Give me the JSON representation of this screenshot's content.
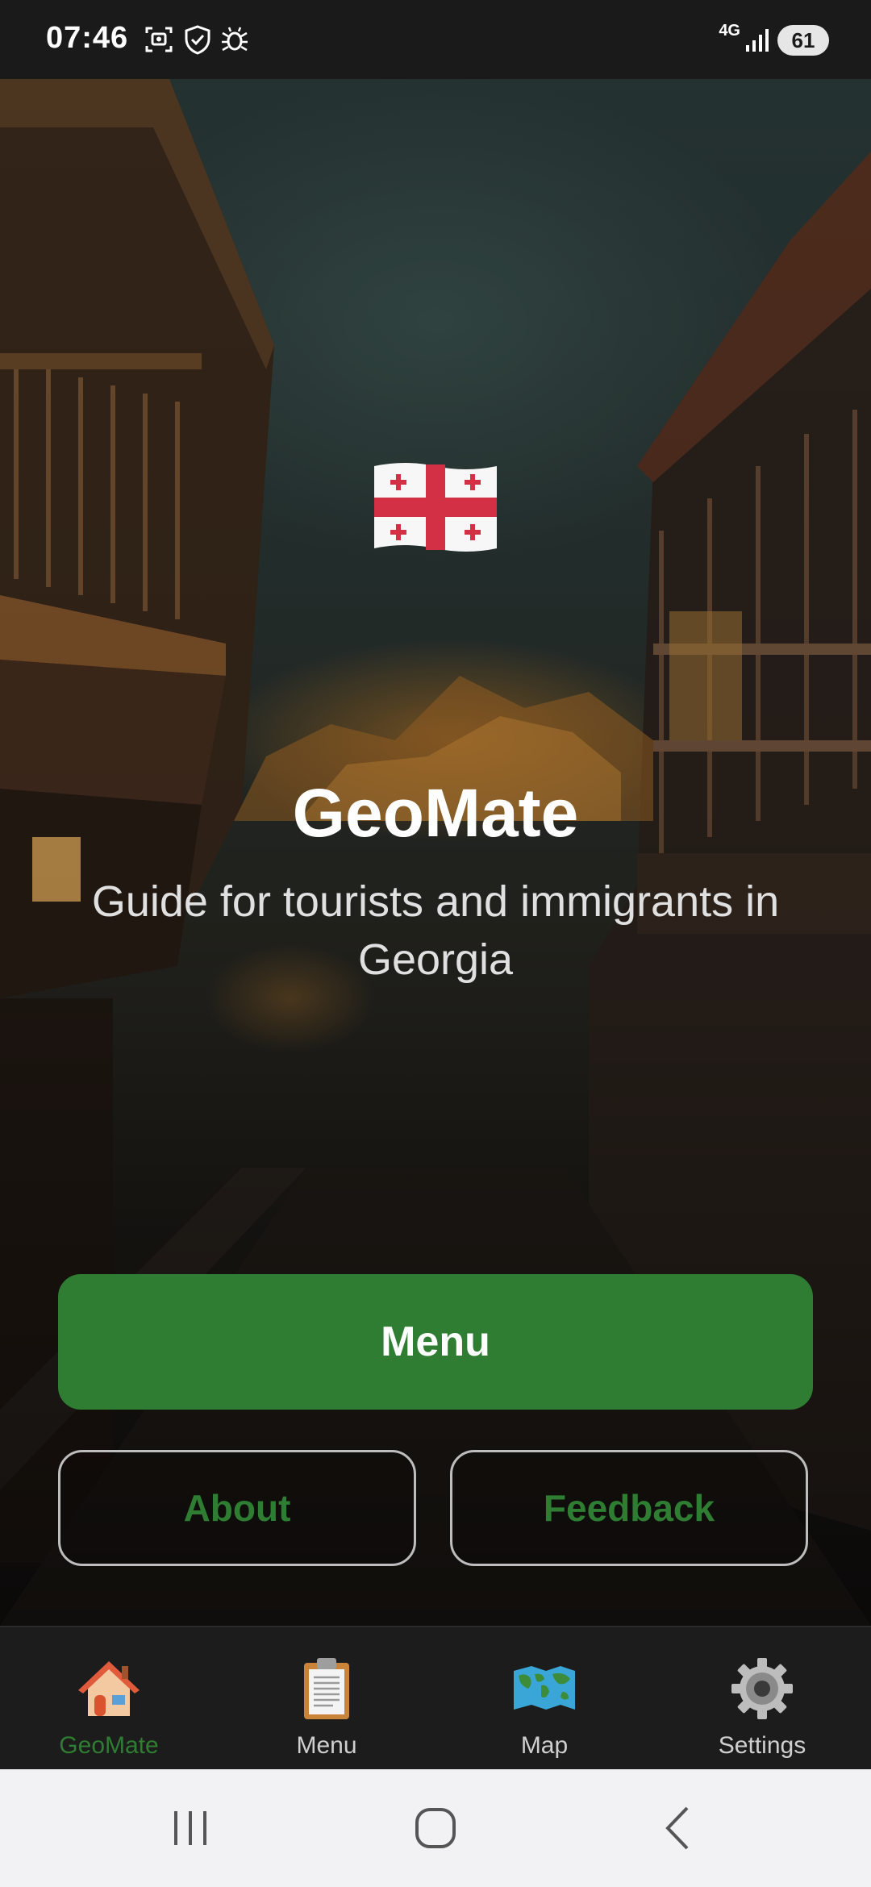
{
  "status_bar": {
    "time": "07:46",
    "network": "4G",
    "battery": "61",
    "icons": [
      "screenshot-icon",
      "shield-check-icon",
      "bug-icon",
      "signal-icon"
    ]
  },
  "hero": {
    "flag": "georgia-flag-icon",
    "title": "GeoMate",
    "subtitle": "Guide for tourists and immigrants in Georgia"
  },
  "actions": {
    "menu_label": "Menu",
    "about_label": "About",
    "feedback_label": "Feedback"
  },
  "bottom_nav": {
    "items": [
      {
        "label": "GeoMate",
        "icon": "house-icon",
        "active": true
      },
      {
        "label": "Menu",
        "icon": "clipboard-icon",
        "active": false
      },
      {
        "label": "Map",
        "icon": "world-map-icon",
        "active": false
      },
      {
        "label": "Settings",
        "icon": "gear-icon",
        "active": false
      }
    ]
  },
  "system_nav": {
    "buttons": [
      "recents-button",
      "home-button",
      "back-button"
    ]
  },
  "colors": {
    "accent": "#2e7d32",
    "status_bar_bg": "#1a1a1a",
    "nav_bg": "#1c1c1c",
    "system_nav_bg": "#f2f2f4"
  }
}
